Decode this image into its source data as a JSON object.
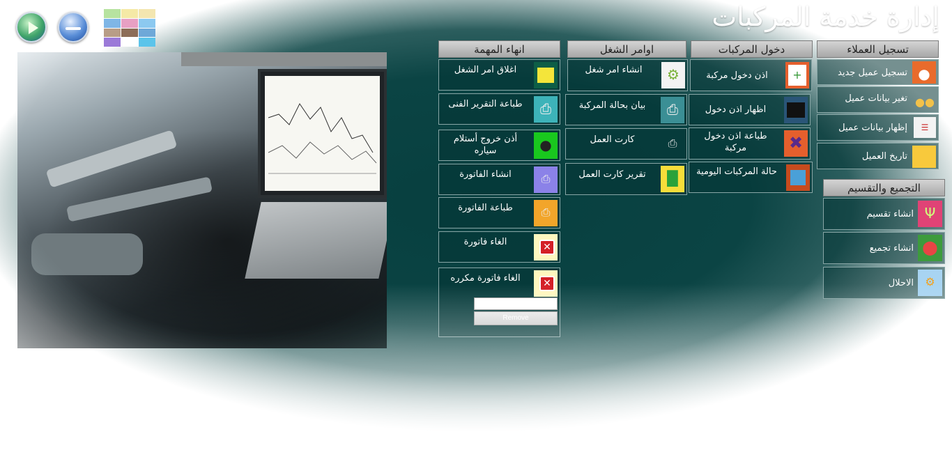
{
  "header": {
    "title": "إدارة خدمة المركبات",
    "play_icon": "play-icon",
    "minimize_icon": "minimize-icon",
    "thumbnail": "apps-thumbnail"
  },
  "columns": {
    "customers": {
      "title": "تسجيل العملاء",
      "items": [
        {
          "label": "تسجيل عميل جديد",
          "icon": "person-icon"
        },
        {
          "label": "تغير بيانات عميل",
          "icon": "users-icon"
        },
        {
          "label": "إظهار بيانات عميل",
          "icon": "list-icon"
        },
        {
          "label": "تاريخ العميل",
          "icon": "folder-icon"
        }
      ]
    },
    "grouping": {
      "title": "التجميع والتقسيم",
      "items": [
        {
          "label": "انشاء تقسيم",
          "icon": "split-icon"
        },
        {
          "label": "انشاء تجميع",
          "icon": "merge-icon"
        },
        {
          "label": "الاحلال",
          "icon": "replace-icon"
        }
      ]
    },
    "vehicles": {
      "title": "دخول المركبات",
      "items": [
        {
          "label": "اذن دخول مركبة",
          "icon": "document-add-icon"
        },
        {
          "label": "اظهار اذن دخول",
          "icon": "folder-dark-icon"
        },
        {
          "label": "طباعة اذن دخول مركبة",
          "icon": "print-cancel-icon"
        },
        {
          "label": "حالة المركبات اليومية",
          "icon": "monitor-icon"
        }
      ]
    },
    "work_orders": {
      "title": "اوامر الشغل",
      "items": [
        {
          "label": "انشاء امر شغل",
          "icon": "gears-icon"
        },
        {
          "label": "بيان بحالة المركبة",
          "icon": "printer-icon"
        },
        {
          "label": "كارت العمل",
          "icon": "small-printer-icon"
        },
        {
          "label": "تقرير كارت العمل",
          "icon": "report-chart-icon"
        }
      ]
    },
    "task_end": {
      "title": "انهاء المهمة",
      "items": [
        {
          "label": "اغلاق امر الشغل",
          "icon": "sticky-notes-icon"
        },
        {
          "label": "طباعة التقرير الفنى",
          "icon": "print-report-icon"
        },
        {
          "label": "أذن خروج أستلام سياره",
          "icon": "person-exit-icon"
        },
        {
          "label": "انشاء الفاتورة",
          "icon": "invoice-create-icon"
        },
        {
          "label": "طباعة الفاتورة",
          "icon": "invoice-print-icon"
        },
        {
          "label": "الغاء فاتورة",
          "icon": "cancel-icon"
        },
        {
          "label": "الغاء فاتورة مكرره",
          "icon": "cancel-duplicate-icon"
        }
      ],
      "remove_input_value": "",
      "remove_button": "Remove"
    }
  },
  "photo": {
    "description_icon": "engine-laptop-photo"
  }
}
